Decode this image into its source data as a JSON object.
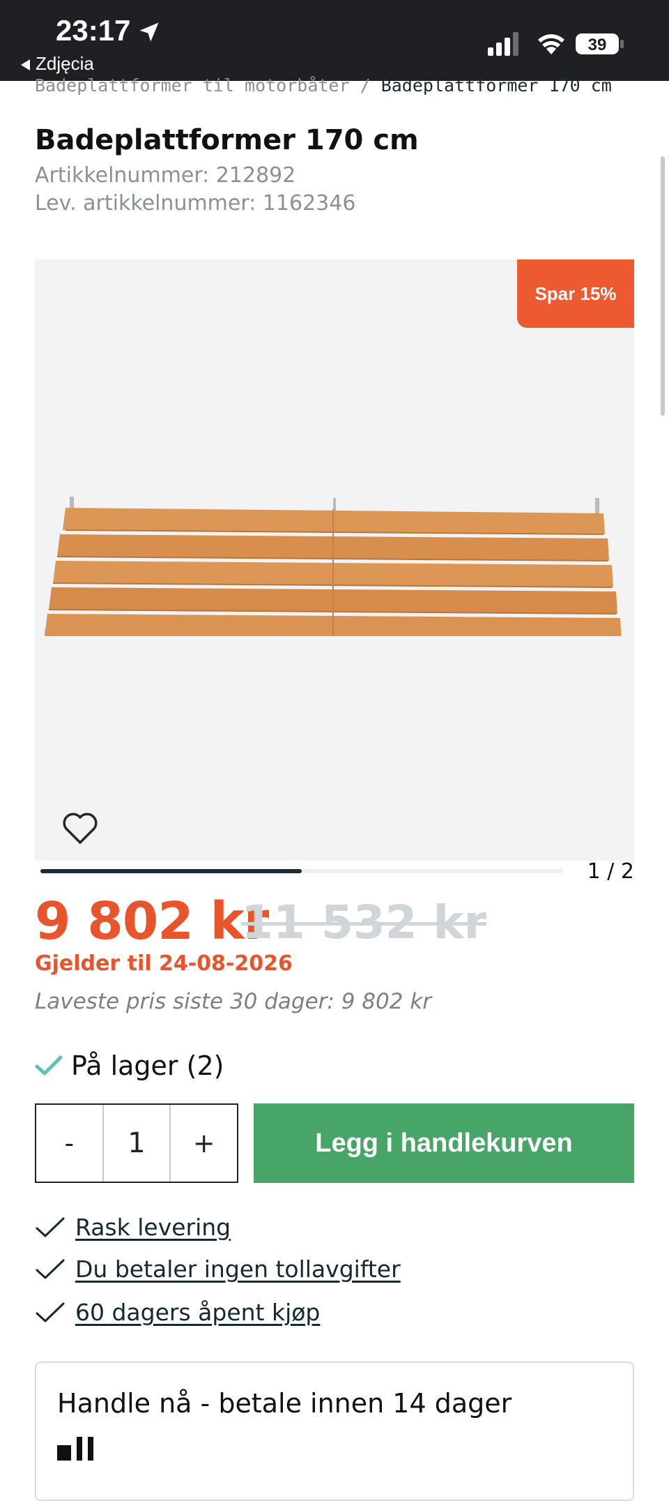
{
  "status_bar": {
    "time": "23:17",
    "back_label": "Zdjęcia",
    "battery": "39"
  },
  "breadcrumb": {
    "parent": "Badeplattformer til motorbåter",
    "separator": " / ",
    "current": "Badeplattformer 170 cm"
  },
  "product": {
    "title": "Badeplattformer 170 cm",
    "article_number": "Artikkelnummer: 212892",
    "supplier_article_number": "Lev. artikkelnummer: 1162346",
    "discount_badge": "Spar 15%",
    "image_icon": "teak-swim-platform",
    "gallery_counter": "1 / 2",
    "gallery_progress": 0.5,
    "price": "9 802 kr",
    "old_price": "11 532 kr",
    "valid_until": "Gjelder til 24-08-2026",
    "lowest_price": "Laveste pris siste 30 dager: 9 802 kr",
    "stock": "På lager (2)"
  },
  "cart": {
    "minus": "-",
    "quantity": "1",
    "plus": "+",
    "add_label": "Legg i handlekurven"
  },
  "usps": [
    "Rask levering",
    "Du betaler ingen tollavgifter",
    "60 dagers åpent kjøp"
  ],
  "payment": {
    "title": "Handle nå - betale innen 14 dager"
  },
  "colors": {
    "accent": "#e8542b",
    "button": "#46a567",
    "check": "#5fbfb3"
  }
}
